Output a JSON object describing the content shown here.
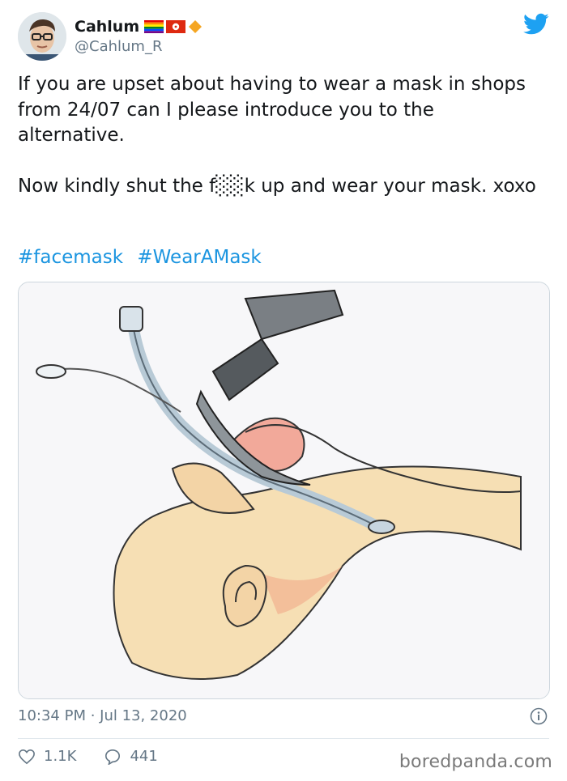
{
  "author": {
    "display_name": "Cahlum",
    "handle": "@Cahlum_R",
    "flags": [
      "rainbow-flag-icon",
      "hong-kong-flag-icon",
      "orange-diamond-icon"
    ]
  },
  "tweet": {
    "text": "If you are upset about having to wear a mask in shops from 24/07 can I please introduce you to the alternative.\n\nNow kindly shut the f░░k up and wear your mask. xoxo",
    "hashtags": [
      "#facemask",
      "#WearAMask"
    ],
    "media_alt": "",
    "timestamp": "10:34 PM · Jul 13, 2020"
  },
  "actions": {
    "likes": "1.1K",
    "replies": "441"
  },
  "icons": {
    "brand": "twitter-bird-icon",
    "info": "info-icon",
    "like": "heart-icon",
    "reply": "speech-bubble-icon"
  },
  "watermark": "boredpanda.com",
  "colors": {
    "twitter_blue": "#1da1f2",
    "link_blue": "#1b95e0",
    "muted": "#657786"
  }
}
